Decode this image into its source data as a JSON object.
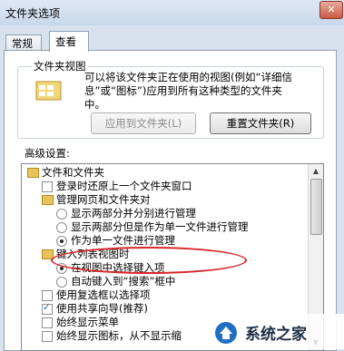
{
  "window": {
    "title": "文件夹选项",
    "close_label": "✕"
  },
  "tabs": [
    {
      "label": "常规"
    },
    {
      "label": "查看"
    }
  ],
  "folder_views": {
    "group_label": "文件夹视图",
    "description_line1": "可以将该文件夹正在使用的视图(例如“详细信",
    "description_line2": "息”或“图标”)应用到所有这种类型的文件夹",
    "description_line3": "中。",
    "apply_button": "应用到文件夹(L)",
    "reset_button": "重置文件夹(R)"
  },
  "advanced": {
    "label": "高级设置:",
    "items": [
      {
        "type": "folder",
        "label": "文件和文件夹"
      },
      {
        "type": "checkbox",
        "checked": false,
        "label": "登录时还原上一个文件夹窗口"
      },
      {
        "type": "folder",
        "label": "管理网页和文件夹对"
      },
      {
        "type": "radio",
        "checked": false,
        "label": "显示两部分并分别进行管理"
      },
      {
        "type": "radio",
        "checked": false,
        "label": "显示两部分但是作为单一文件进行管理"
      },
      {
        "type": "radio",
        "checked": true,
        "label": "作为单一文件进行管理"
      },
      {
        "type": "folder",
        "label": "键入列表视图时"
      },
      {
        "type": "radio",
        "checked": true,
        "label": "在视图中选择键入项"
      },
      {
        "type": "radio",
        "checked": false,
        "label": "自动键入到“搜索”框中"
      },
      {
        "type": "checkbox",
        "checked": false,
        "label": "使用复选框以选择项"
      },
      {
        "type": "checkbox",
        "checked": true,
        "label": "使用共享向导(推荐)"
      },
      {
        "type": "checkbox",
        "checked": false,
        "label": "始终显示菜单"
      },
      {
        "type": "checkbox",
        "checked": false,
        "label": "始终显示图标，从不显示缩"
      }
    ]
  },
  "watermark": {
    "text": "系统之家"
  }
}
